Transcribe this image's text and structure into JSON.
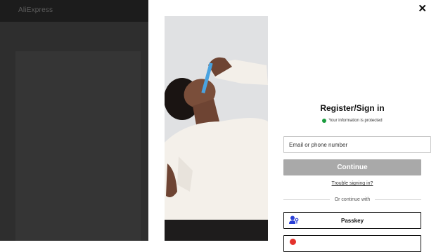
{
  "background": {
    "brand": "AliExpress"
  },
  "modal": {
    "title": "Register/Sign in",
    "secure_text": "Your information is protected",
    "email_placeholder": "Email or phone number",
    "continue_label": "Continue",
    "trouble_link": "Trouble signing in?",
    "divider_text": "Or continue with",
    "passkey_label": "Passkey",
    "close_glyph": "✕"
  },
  "colors": {
    "accent_green": "#1a9c3e",
    "disabled_button": "#a9a9a9",
    "overlay": "#2e2e2e",
    "passkey_icon": "#2a3fd6"
  },
  "icons": [
    "close-icon",
    "shield-check-icon",
    "passkey-user-icon",
    "google-icon"
  ]
}
